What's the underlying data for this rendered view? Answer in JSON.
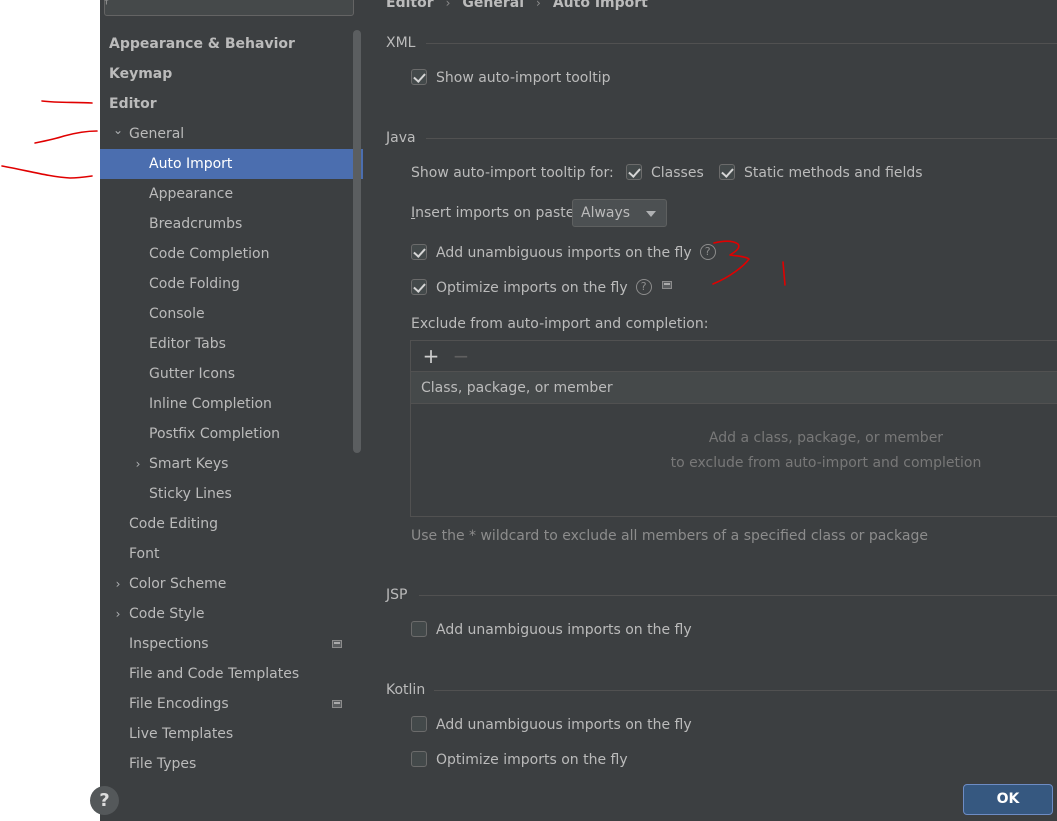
{
  "sidebar": {
    "items": [
      {
        "label": "Appearance & Behavior",
        "bold": true,
        "level": 0,
        "chevron": ""
      },
      {
        "label": "Keymap",
        "bold": true,
        "level": 0,
        "chevron": ""
      },
      {
        "label": "Editor",
        "bold": true,
        "level": 0,
        "chevron": ""
      },
      {
        "label": "General",
        "bold": false,
        "level": 1,
        "chevron": "chevron-down"
      },
      {
        "label": "Auto Import",
        "bold": false,
        "level": 2,
        "chevron": "",
        "selected": true
      },
      {
        "label": "Appearance",
        "bold": false,
        "level": 2,
        "chevron": ""
      },
      {
        "label": "Breadcrumbs",
        "bold": false,
        "level": 2,
        "chevron": ""
      },
      {
        "label": "Code Completion",
        "bold": false,
        "level": 2,
        "chevron": ""
      },
      {
        "label": "Code Folding",
        "bold": false,
        "level": 2,
        "chevron": ""
      },
      {
        "label": "Console",
        "bold": false,
        "level": 2,
        "chevron": ""
      },
      {
        "label": "Editor Tabs",
        "bold": false,
        "level": 2,
        "chevron": ""
      },
      {
        "label": "Gutter Icons",
        "bold": false,
        "level": 2,
        "chevron": ""
      },
      {
        "label": "Inline Completion",
        "bold": false,
        "level": 2,
        "chevron": ""
      },
      {
        "label": "Postfix Completion",
        "bold": false,
        "level": 2,
        "chevron": ""
      },
      {
        "label": "Smart Keys",
        "bold": false,
        "level": 2,
        "chevron": "chevron-right"
      },
      {
        "label": "Sticky Lines",
        "bold": false,
        "level": 2,
        "chevron": ""
      },
      {
        "label": "Code Editing",
        "bold": false,
        "level": 1,
        "chevron": ""
      },
      {
        "label": "Font",
        "bold": false,
        "level": 1,
        "chevron": ""
      },
      {
        "label": "Color Scheme",
        "bold": false,
        "level": 1,
        "chevron": "chevron-right"
      },
      {
        "label": "Code Style",
        "bold": false,
        "level": 1,
        "chevron": "chevron-right"
      },
      {
        "label": "Inspections",
        "bold": false,
        "level": 1,
        "chevron": "",
        "project_icon": true
      },
      {
        "label": "File and Code Templates",
        "bold": false,
        "level": 1,
        "chevron": ""
      },
      {
        "label": "File Encodings",
        "bold": false,
        "level": 1,
        "chevron": "",
        "project_icon": true
      },
      {
        "label": "Live Templates",
        "bold": false,
        "level": 1,
        "chevron": ""
      },
      {
        "label": "File Types",
        "bold": false,
        "level": 1,
        "chevron": ""
      }
    ]
  },
  "breadcrumb": {
    "items": [
      "Editor",
      "General",
      "Auto Import"
    ],
    "separator": "›"
  },
  "xml": {
    "title": "XML",
    "show_tooltip": {
      "label": "Show auto-import tooltip",
      "checked": true
    }
  },
  "java": {
    "title": "Java",
    "tooltip_for_label": "Show auto-import tooltip for:",
    "classes": {
      "label": "Classes",
      "checked": true
    },
    "static_methods": {
      "label": "Static methods and fields",
      "checked": true
    },
    "insert_label_prefix": "I",
    "insert_label_rest": "nsert imports on paste:",
    "insert_value": "Always",
    "add_unambiguous": {
      "label": "Add unambiguous imports on the fly",
      "checked": true
    },
    "optimize": {
      "label": "Optimize imports on the fly",
      "checked": true
    },
    "exclude_label": "Exclude from auto-import and completion:",
    "table_header": "Class, package, or member",
    "empty_line1": "Add a class, package, or member",
    "empty_line2": "to exclude from auto-import and completion",
    "wildcard_hint": "Use the * wildcard to exclude all members of a specified class or package",
    "add_symbol": "+",
    "remove_symbol": "−"
  },
  "jsp": {
    "title": "JSP",
    "add_unambiguous": {
      "label": "Add unambiguous imports on the fly",
      "checked": false
    }
  },
  "kotlin": {
    "title": "Kotlin",
    "add_unambiguous": {
      "label": "Add unambiguous imports on the fly",
      "checked": false
    },
    "optimize": {
      "label": "Optimize imports on the fly",
      "checked": false
    }
  },
  "bottom": {
    "help_symbol": "?",
    "ok_label": "OK"
  },
  "icons": {
    "question": "?",
    "chevron_down": "⌄",
    "chevron_right": "›"
  },
  "colors": {
    "background": "#3c3f41",
    "selection": "#4b6eaf",
    "ok_button": "#365880",
    "annotation": "#e00000"
  }
}
